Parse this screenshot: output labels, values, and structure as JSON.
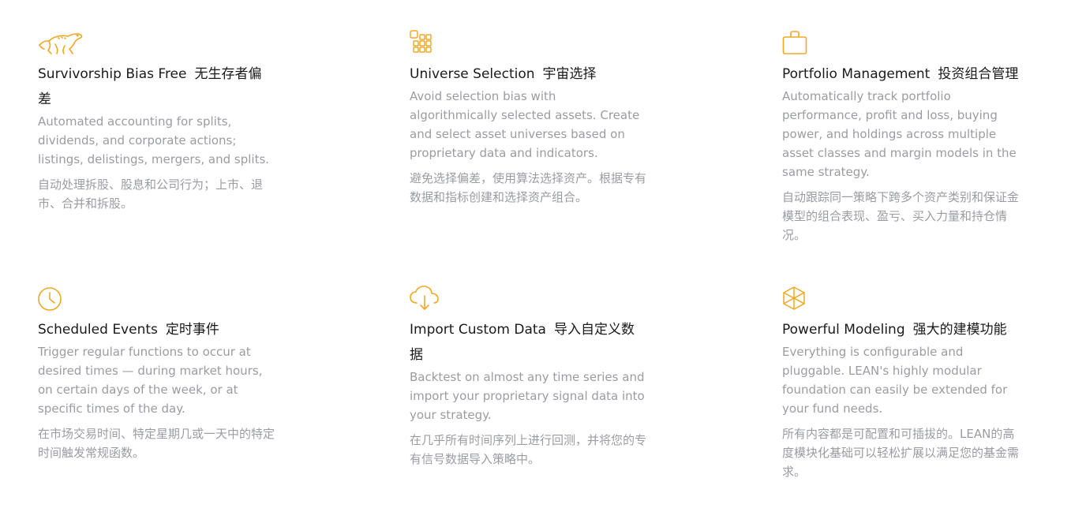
{
  "theme": {
    "accent": "#f0a823",
    "title_color": "#1a1a1a",
    "text_color": "#9a9ca3"
  },
  "features": [
    {
      "icon": "cheetah-icon",
      "title_en": "Survivorship Bias Free",
      "title_zh": "无生存者偏差",
      "desc_en": "Automated accounting for splits, dividends, and corporate actions; listings, delistings, mergers, and splits.",
      "desc_zh": "自动处理拆股、股息和公司行为；上市、退市、合并和拆股。"
    },
    {
      "icon": "grid-icon",
      "title_en": "Universe Selection",
      "title_zh": "宇宙选择",
      "desc_en": "Avoid selection bias with algorithmically selected assets. Create and select asset universes based on proprietary data and indicators.",
      "desc_zh": "避免选择偏差，使用算法选择资产。根据专有数据和指标创建和选择资产组合。"
    },
    {
      "icon": "briefcase-icon",
      "title_en": "Portfolio Management",
      "title_zh": "投资组合管理",
      "desc_en": "Automatically track portfolio performance, profit and loss, buying power, and holdings across multiple asset classes and margin models in the same strategy.",
      "desc_zh": "自动跟踪同一策略下跨多个资产类别和保证金模型的组合表现、盈亏、买入力量和持仓情况。"
    },
    {
      "icon": "clock-icon",
      "title_en": "Scheduled Events",
      "title_zh": "定时事件",
      "desc_en": "Trigger regular functions to occur at desired times — during market hours, on certain days of the week, or at specific times of the day.",
      "desc_zh": "在市场交易时间、特定星期几或一天中的特定时间触发常规函数。"
    },
    {
      "icon": "cloud-download-icon",
      "title_en": "Import Custom Data",
      "title_zh": "导入自定义数据",
      "desc_en": "Backtest on almost any time series and import your proprietary signal data into your strategy.",
      "desc_zh": "在几乎所有时间序列上进行回测，并将您的专有信号数据导入策略中。"
    },
    {
      "icon": "cube-icon",
      "title_en": "Powerful Modeling",
      "title_zh": "强大的建模功能",
      "desc_en": "Everything is configurable and pluggable. LEAN's highly modular foundation can easily be extended for your fund needs.",
      "desc_zh": "所有内容都是可配置和可插拔的。LEAN的高度模块化基础可以轻松扩展以满足您的基金需求。"
    }
  ]
}
